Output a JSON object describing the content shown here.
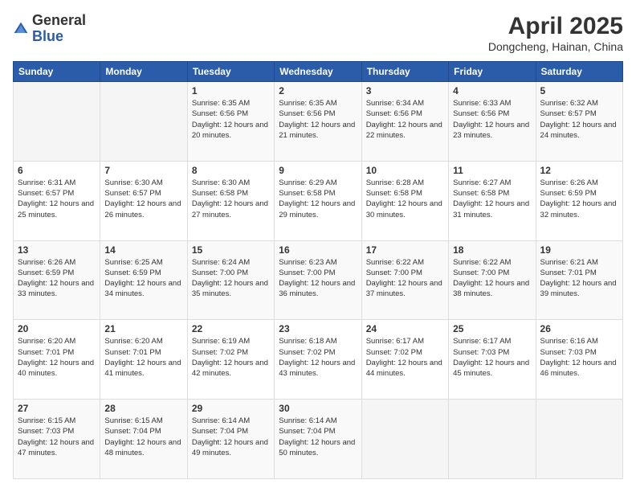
{
  "logo": {
    "text_general": "General",
    "text_blue": "Blue"
  },
  "header": {
    "month_title": "April 2025",
    "location": "Dongcheng, Hainan, China"
  },
  "weekdays": [
    "Sunday",
    "Monday",
    "Tuesday",
    "Wednesday",
    "Thursday",
    "Friday",
    "Saturday"
  ],
  "weeks": [
    [
      {
        "day": "",
        "sunrise": "",
        "sunset": "",
        "daylight": ""
      },
      {
        "day": "",
        "sunrise": "",
        "sunset": "",
        "daylight": ""
      },
      {
        "day": "1",
        "sunrise": "Sunrise: 6:35 AM",
        "sunset": "Sunset: 6:56 PM",
        "daylight": "Daylight: 12 hours and 20 minutes."
      },
      {
        "day": "2",
        "sunrise": "Sunrise: 6:35 AM",
        "sunset": "Sunset: 6:56 PM",
        "daylight": "Daylight: 12 hours and 21 minutes."
      },
      {
        "day": "3",
        "sunrise": "Sunrise: 6:34 AM",
        "sunset": "Sunset: 6:56 PM",
        "daylight": "Daylight: 12 hours and 22 minutes."
      },
      {
        "day": "4",
        "sunrise": "Sunrise: 6:33 AM",
        "sunset": "Sunset: 6:56 PM",
        "daylight": "Daylight: 12 hours and 23 minutes."
      },
      {
        "day": "5",
        "sunrise": "Sunrise: 6:32 AM",
        "sunset": "Sunset: 6:57 PM",
        "daylight": "Daylight: 12 hours and 24 minutes."
      }
    ],
    [
      {
        "day": "6",
        "sunrise": "Sunrise: 6:31 AM",
        "sunset": "Sunset: 6:57 PM",
        "daylight": "Daylight: 12 hours and 25 minutes."
      },
      {
        "day": "7",
        "sunrise": "Sunrise: 6:30 AM",
        "sunset": "Sunset: 6:57 PM",
        "daylight": "Daylight: 12 hours and 26 minutes."
      },
      {
        "day": "8",
        "sunrise": "Sunrise: 6:30 AM",
        "sunset": "Sunset: 6:58 PM",
        "daylight": "Daylight: 12 hours and 27 minutes."
      },
      {
        "day": "9",
        "sunrise": "Sunrise: 6:29 AM",
        "sunset": "Sunset: 6:58 PM",
        "daylight": "Daylight: 12 hours and 29 minutes."
      },
      {
        "day": "10",
        "sunrise": "Sunrise: 6:28 AM",
        "sunset": "Sunset: 6:58 PM",
        "daylight": "Daylight: 12 hours and 30 minutes."
      },
      {
        "day": "11",
        "sunrise": "Sunrise: 6:27 AM",
        "sunset": "Sunset: 6:58 PM",
        "daylight": "Daylight: 12 hours and 31 minutes."
      },
      {
        "day": "12",
        "sunrise": "Sunrise: 6:26 AM",
        "sunset": "Sunset: 6:59 PM",
        "daylight": "Daylight: 12 hours and 32 minutes."
      }
    ],
    [
      {
        "day": "13",
        "sunrise": "Sunrise: 6:26 AM",
        "sunset": "Sunset: 6:59 PM",
        "daylight": "Daylight: 12 hours and 33 minutes."
      },
      {
        "day": "14",
        "sunrise": "Sunrise: 6:25 AM",
        "sunset": "Sunset: 6:59 PM",
        "daylight": "Daylight: 12 hours and 34 minutes."
      },
      {
        "day": "15",
        "sunrise": "Sunrise: 6:24 AM",
        "sunset": "Sunset: 7:00 PM",
        "daylight": "Daylight: 12 hours and 35 minutes."
      },
      {
        "day": "16",
        "sunrise": "Sunrise: 6:23 AM",
        "sunset": "Sunset: 7:00 PM",
        "daylight": "Daylight: 12 hours and 36 minutes."
      },
      {
        "day": "17",
        "sunrise": "Sunrise: 6:22 AM",
        "sunset": "Sunset: 7:00 PM",
        "daylight": "Daylight: 12 hours and 37 minutes."
      },
      {
        "day": "18",
        "sunrise": "Sunrise: 6:22 AM",
        "sunset": "Sunset: 7:00 PM",
        "daylight": "Daylight: 12 hours and 38 minutes."
      },
      {
        "day": "19",
        "sunrise": "Sunrise: 6:21 AM",
        "sunset": "Sunset: 7:01 PM",
        "daylight": "Daylight: 12 hours and 39 minutes."
      }
    ],
    [
      {
        "day": "20",
        "sunrise": "Sunrise: 6:20 AM",
        "sunset": "Sunset: 7:01 PM",
        "daylight": "Daylight: 12 hours and 40 minutes."
      },
      {
        "day": "21",
        "sunrise": "Sunrise: 6:20 AM",
        "sunset": "Sunset: 7:01 PM",
        "daylight": "Daylight: 12 hours and 41 minutes."
      },
      {
        "day": "22",
        "sunrise": "Sunrise: 6:19 AM",
        "sunset": "Sunset: 7:02 PM",
        "daylight": "Daylight: 12 hours and 42 minutes."
      },
      {
        "day": "23",
        "sunrise": "Sunrise: 6:18 AM",
        "sunset": "Sunset: 7:02 PM",
        "daylight": "Daylight: 12 hours and 43 minutes."
      },
      {
        "day": "24",
        "sunrise": "Sunrise: 6:17 AM",
        "sunset": "Sunset: 7:02 PM",
        "daylight": "Daylight: 12 hours and 44 minutes."
      },
      {
        "day": "25",
        "sunrise": "Sunrise: 6:17 AM",
        "sunset": "Sunset: 7:03 PM",
        "daylight": "Daylight: 12 hours and 45 minutes."
      },
      {
        "day": "26",
        "sunrise": "Sunrise: 6:16 AM",
        "sunset": "Sunset: 7:03 PM",
        "daylight": "Daylight: 12 hours and 46 minutes."
      }
    ],
    [
      {
        "day": "27",
        "sunrise": "Sunrise: 6:15 AM",
        "sunset": "Sunset: 7:03 PM",
        "daylight": "Daylight: 12 hours and 47 minutes."
      },
      {
        "day": "28",
        "sunrise": "Sunrise: 6:15 AM",
        "sunset": "Sunset: 7:04 PM",
        "daylight": "Daylight: 12 hours and 48 minutes."
      },
      {
        "day": "29",
        "sunrise": "Sunrise: 6:14 AM",
        "sunset": "Sunset: 7:04 PM",
        "daylight": "Daylight: 12 hours and 49 minutes."
      },
      {
        "day": "30",
        "sunrise": "Sunrise: 6:14 AM",
        "sunset": "Sunset: 7:04 PM",
        "daylight": "Daylight: 12 hours and 50 minutes."
      },
      {
        "day": "",
        "sunrise": "",
        "sunset": "",
        "daylight": ""
      },
      {
        "day": "",
        "sunrise": "",
        "sunset": "",
        "daylight": ""
      },
      {
        "day": "",
        "sunrise": "",
        "sunset": "",
        "daylight": ""
      }
    ]
  ]
}
